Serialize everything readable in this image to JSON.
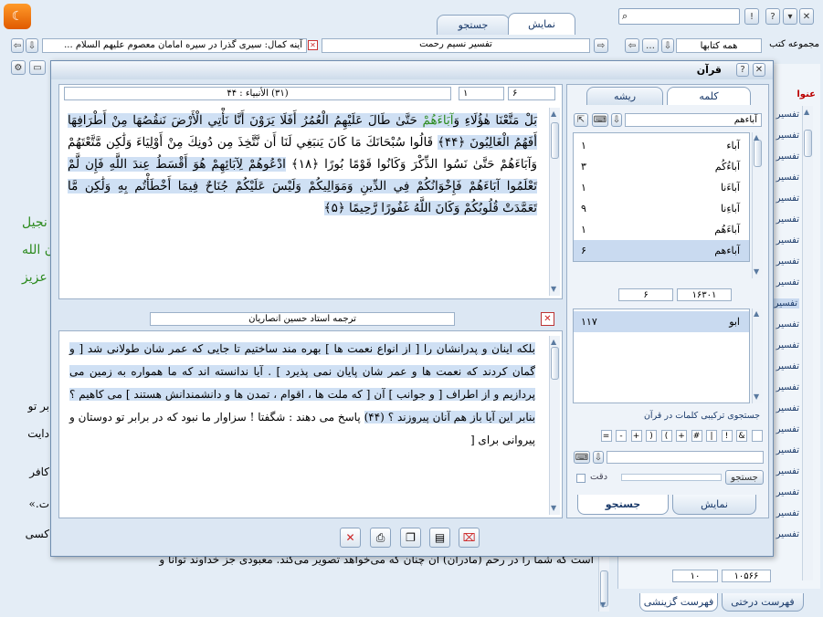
{
  "top_tabs": {
    "display": "نمایش",
    "search": "جستجو"
  },
  "collection": {
    "label": "مجموعه کتب",
    "selected": "همه کتابها"
  },
  "open_tabs": [
    {
      "label": "تفسیر نسیم رحمت"
    },
    {
      "label": "آینه کمال: سیری گذرا در سیره امامان معصوم علیهم السلام ..."
    }
  ],
  "right_panel": {
    "header": "عنوا",
    "list_item": "تفسیر",
    "page_fields": {
      "left": "۱۰",
      "right": "۱۰۵۶۶"
    },
    "bottom_tabs": {
      "tree": "فهرست درختی",
      "selective": "فهرست گزینشی"
    }
  },
  "background_text": {
    "left_fragments": [
      "نجیل",
      "ن الله",
      "عزیز"
    ],
    "mid_fragments": [
      "بر تو",
      "دایت",
      "کافر",
      "ت.»",
      "کسی"
    ],
    "bottom_line": "است که شما را در رحم (مادران) آن چنان که می‌خواهد تصویر می‌کند. معبودی جز خداوند توانا و"
  },
  "quran_window": {
    "title": "قرآن",
    "nav": {
      "page": "۶",
      "juz": "۱",
      "surah_info": "(۳۱) الأنبياء : ۴۴"
    },
    "verses": [
      "بَلْ مَتَّعْنَا هٰؤُلَاءِ وَ",
      "آبَاءَهُمْ",
      " حَتَّىٰ طَالَ عَلَيْهِمُ الْعُمُرُ أَفَلَا يَرَوْنَ أَنَّا نَأْتِي الْأَرْضَ نَنقُصُهَا مِنْ أَطْرَافِهَا أَفَهُمُ الْغَالِبُونَ ﴿۴۴﴾",
      "قَالُوا سُبْحَانَكَ مَا كَانَ يَنبَغِي لَنَا أَن نَّتَّخِذَ مِن دُونِكَ مِنْ أَوْلِيَاءَ وَلَٰكِن مَّتَّعْتَهُمْ وَآبَاءَهُمْ حَتَّىٰ نَسُوا الذِّكْرَ وَكَانُوا قَوْمًا بُورًا ﴿۱۸﴾",
      "ادْعُوهُمْ لِآبَائِهِمْ هُوَ أَقْسَطُ عِندَ اللَّهِ فَإِن لَّمْ تَعْلَمُوا آبَاءَهُمْ فَإِخْوَانُكُمْ فِي الدِّينِ وَمَوَالِيكُمْ وَلَيْسَ عَلَيْكُمْ جُنَاحٌ فِيمَا أَخْطَأْتُم بِهِ وَلَٰكِن مَّا تَعَمَّدَتْ قُلُوبُكُمْ وَكَانَ اللَّهُ غَفُورًا رَّحِيمًا ﴿۵﴾"
    ],
    "translator": "ترجمه استاد حسین انصاریان",
    "translation": [
      "بلکه اینان و پدرانشان را [ از انواع نعمت ها ] بهره مند ساختیم تا جایی که عمر شان طولانی شد [ و گمان کردند که نعمت ها و عمر شان پایان نمی پذیرد ] . آیا ندانسته اند که ما همواره به زمین می پردازیم و از اطراف [ و جوانب ] آن [ که ملت ها ، اقوام ، تمدن ها و دانشمندانش هستند ] می کاهیم ؟ بنابر این آیا باز هم آنان پیروزند ؟ (۴۴)",
      "پاسخ می دهند : شگفتا ! سزاوار ما نبود که در برابر تو دوستان و پیروانی برای ["
    ],
    "side_tabs": {
      "word": "کلمه",
      "root": "ریشه"
    },
    "search_value": "آباءهم",
    "words": [
      {
        "w": "آباء",
        "n": "۱"
      },
      {
        "w": "آباءُکُم",
        "n": "۳"
      },
      {
        "w": "آباءَنا",
        "n": "۱"
      },
      {
        "w": "آباءِنا",
        "n": "۹"
      },
      {
        "w": "آباءَهُم",
        "n": "۱"
      },
      {
        "w": "آباءهم",
        "n": "۶"
      }
    ],
    "count_fields": {
      "left": "۶",
      "right": "۱۶۳۰۱"
    },
    "results": [
      {
        "w": "ابو",
        "n": "۱۱۷"
      }
    ],
    "combo_label": "جستجوی ترکیبی کلمات در قرآن",
    "symbols": [
      "&",
      "!",
      "|",
      "#",
      "+",
      "(",
      ")",
      "+",
      "-",
      "="
    ],
    "search_button": "جستجو",
    "exact_label": "دقت",
    "bottom_tabs": {
      "display": "نمایش",
      "search": "جستجو"
    }
  }
}
